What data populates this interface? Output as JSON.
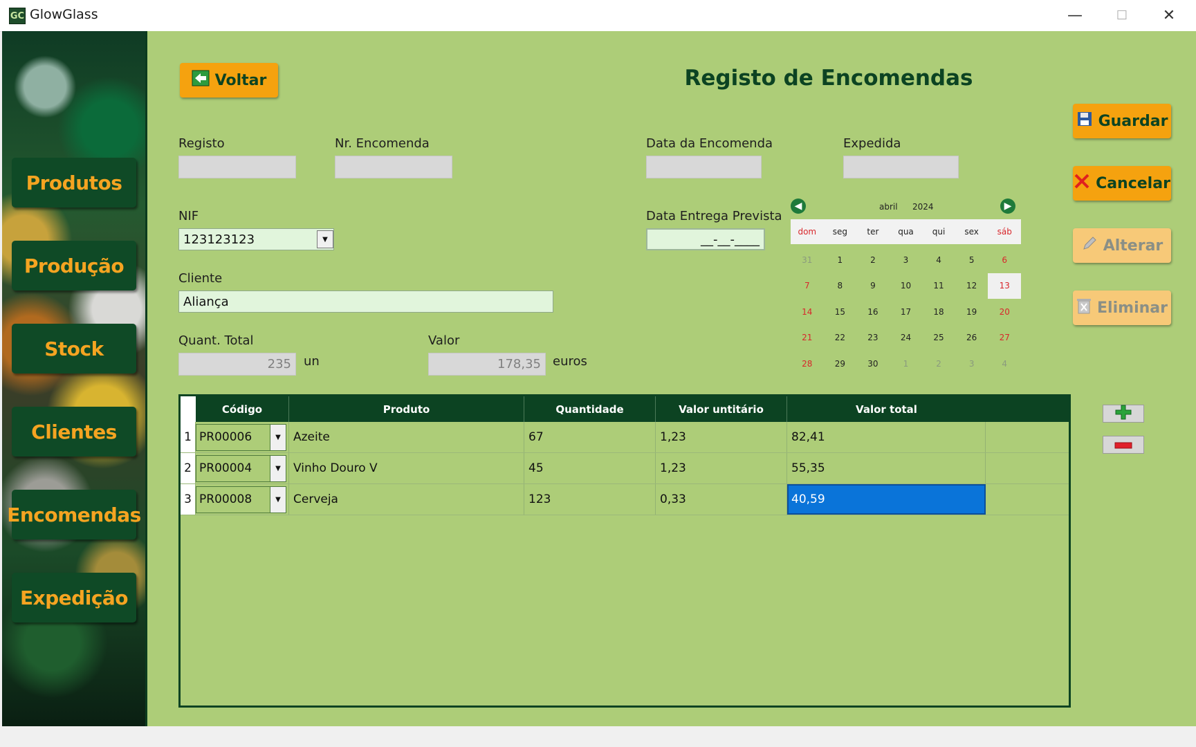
{
  "window": {
    "title": "GlowGlass",
    "app_icon_text": "GC",
    "minimize": "—",
    "maximize": "☐",
    "close": "✕"
  },
  "sidebar": {
    "items": [
      {
        "label": "Produtos"
      },
      {
        "label": "Produção"
      },
      {
        "label": "Stock"
      },
      {
        "label": "Clientes"
      },
      {
        "label": "Encomendas"
      },
      {
        "label": "Expedição"
      }
    ]
  },
  "header": {
    "back_label": "Voltar",
    "title": "Registo de Encomendas"
  },
  "actions": {
    "save_label": "Guardar",
    "cancel_label": "Cancelar",
    "edit_label": "Alterar",
    "delete_label": "Eliminar"
  },
  "form": {
    "registo": {
      "label": "Registo",
      "value": ""
    },
    "nr_encomenda": {
      "label": "Nr. Encomenda",
      "value": ""
    },
    "data_encomenda": {
      "label": "Data da Encomenda",
      "value": ""
    },
    "expedida": {
      "label": "Expedida",
      "value": ""
    },
    "nif": {
      "label": "NIF",
      "value": "123123123"
    },
    "data_entrega": {
      "label": "Data Entrega Prevista",
      "value": "__-__-____"
    },
    "cliente": {
      "label": "Cliente",
      "value": "Aliança"
    },
    "quant_total": {
      "label": "Quant. Total",
      "value": "235",
      "unit": "un"
    },
    "valor": {
      "label": "Valor",
      "value": "178,35",
      "unit": "euros"
    }
  },
  "calendar": {
    "month": "abril",
    "year": "2024",
    "weekdays": [
      "dom",
      "seg",
      "ter",
      "qua",
      "qui",
      "sex",
      "sáb"
    ],
    "days": [
      "31",
      "1",
      "2",
      "3",
      "4",
      "5",
      "6",
      "7",
      "8",
      "9",
      "10",
      "11",
      "12",
      "13",
      "14",
      "15",
      "16",
      "17",
      "18",
      "19",
      "20",
      "21",
      "22",
      "23",
      "24",
      "25",
      "26",
      "27",
      "28",
      "29",
      "30",
      "1",
      "2",
      "3",
      "4"
    ],
    "today": "13"
  },
  "grid": {
    "columns": [
      "Código",
      "Produto",
      "Quantidade",
      "Valor untitário",
      "Valor total"
    ],
    "rows": [
      {
        "n": "1",
        "codigo": "PR00006",
        "produto": "Azeite",
        "quantidade": "67",
        "valor_unit": "1,23",
        "valor_total": "82,41"
      },
      {
        "n": "2",
        "codigo": "PR00004",
        "produto": "Vinho Douro V",
        "quantidade": "45",
        "valor_unit": "1,23",
        "valor_total": "55,35"
      },
      {
        "n": "3",
        "codigo": "PR00008",
        "produto": "Cerveja",
        "quantidade": "123",
        "valor_unit": "0,33",
        "valor_total": "40,59"
      }
    ]
  },
  "colors": {
    "background": "#adcd78",
    "dark_green": "#0c4322",
    "orange": "#f5a20f",
    "selection": "#0a74d9"
  }
}
